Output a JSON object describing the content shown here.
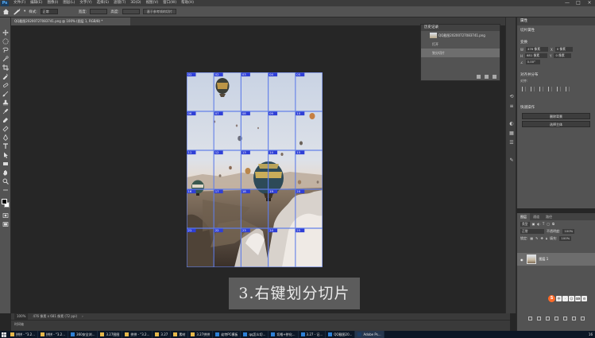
{
  "menubar": {
    "app_icon": "Ps",
    "items": [
      "文件(F)",
      "编辑(E)",
      "图像(I)",
      "图层(L)",
      "文字(Y)",
      "选择(S)",
      "滤镜(T)",
      "3D(D)",
      "视图(V)",
      "窗口(W)",
      "帮助(H)"
    ],
    "window_controls": [
      "—",
      "□",
      "×"
    ]
  },
  "options": {
    "style_label": "样式:",
    "style_value": "正常",
    "width_label": "宽度:",
    "height_label": "高度:",
    "slice_button": "基于参考线的切片"
  },
  "document": {
    "tab_title": "QQ截图20200727083741.png @ 100% (图层 1, RGB/8) *"
  },
  "slices": {
    "labels": [
      "01",
      "02",
      "03",
      "04",
      "05",
      "06",
      "07",
      "08",
      "09",
      "10",
      "11",
      "12",
      "13",
      "14",
      "15",
      "16",
      "17",
      "18",
      "19",
      "20",
      "21",
      "22",
      "23",
      "24",
      "25"
    ]
  },
  "caption": {
    "text": "3.右键划分切片"
  },
  "history": {
    "title": "历史记录",
    "snapshot": "QQ截图20200727083741.png",
    "steps": [
      "打开",
      "划分切片"
    ]
  },
  "properties": {
    "tab": "属性",
    "doc_label": "切片属性",
    "transform_title": "变换",
    "w_label": "W",
    "w_value": "476 像素",
    "x_label": "X",
    "x_value": "0 像素",
    "h_label": "H",
    "h_value": "681 像素",
    "y_label": "Y",
    "y_value": "0 像素",
    "angle_value": "0.00°",
    "align_title": "对齐并分布",
    "align_sub": "对齐:",
    "quick_title": "快速操作",
    "btn_remove_bg": "删除背景",
    "btn_select_subject": "选择主体"
  },
  "layers": {
    "tabs": [
      "图层",
      "通道",
      "路径"
    ],
    "filter_type": "类型",
    "blend_mode": "正常",
    "opacity_label": "不透明度:",
    "opacity_value": "100%",
    "lock_label": "锁定:",
    "fill_label": "填充:",
    "fill_value": "100%",
    "layer_name": "图层 1"
  },
  "status": {
    "zoom": "100%",
    "dims": "476 像素 x 681 像素 (72 ppi)"
  },
  "timeline": {
    "label": "时间轴"
  },
  "ime": {
    "logo": "S",
    "items": [
      "中",
      "·",
      "☺",
      "⌨",
      "⚙"
    ]
  },
  "taskbar": {
    "items": [
      "拼拼 - \"3.2...",
      "拼拼 - \"3.2...",
      "360安全浏...",
      "3.27图图",
      "拼拼 - \"3.2...",
      "3.27",
      "素材",
      "3.27拼拼",
      "幼特PC模板",
      "qq怎么切...",
      "切格+拼化...",
      "3.27 - 记...",
      "QQ截图20...",
      "Adobe Ps..."
    ],
    "clock": "16"
  },
  "colors": {
    "slice_border": "#5f7de8",
    "slice_label_bg": "#2f3fd6",
    "panel_bg": "#535353",
    "workspace_bg": "#262626",
    "caption_bg": "#5f5f5f"
  }
}
